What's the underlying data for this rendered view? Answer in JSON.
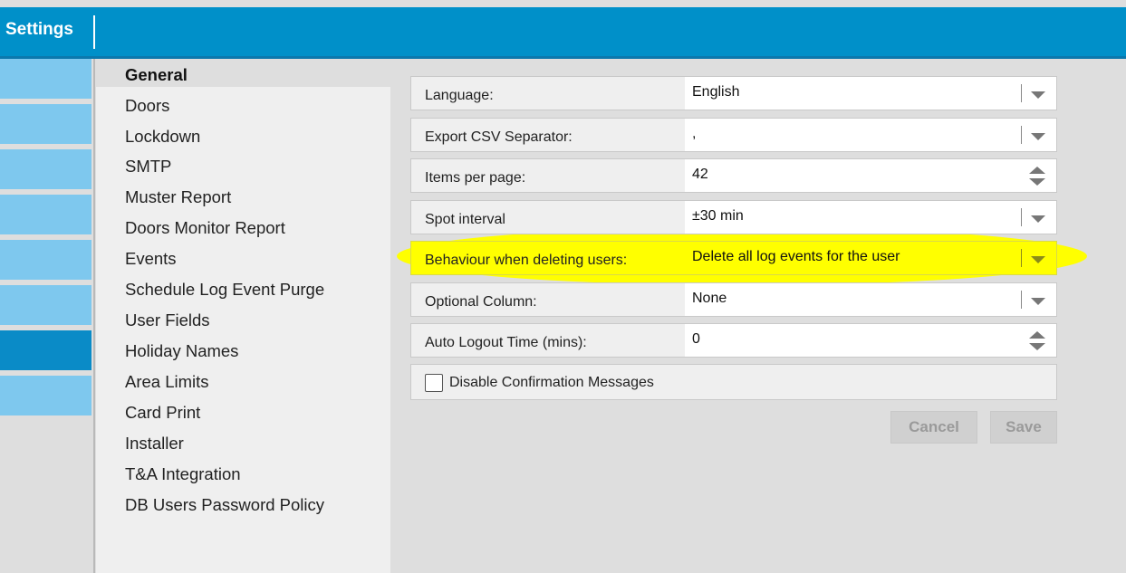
{
  "header": {
    "title": "Settings"
  },
  "leftnav": {
    "tiles": 8,
    "active_index": 6
  },
  "submenu": {
    "items": [
      {
        "label": "General",
        "active": true
      },
      {
        "label": "Doors"
      },
      {
        "label": "Lockdown"
      },
      {
        "label": "SMTP"
      },
      {
        "label": "Muster Report"
      },
      {
        "label": "Doors Monitor Report"
      },
      {
        "label": "Events"
      },
      {
        "label": "Schedule Log Event Purge"
      },
      {
        "label": "User Fields"
      },
      {
        "label": "Holiday Names"
      },
      {
        "label": "Area Limits"
      },
      {
        "label": "Card Print"
      },
      {
        "label": "Installer"
      },
      {
        "label": "T&A Integration"
      },
      {
        "label": "DB Users Password Policy"
      }
    ]
  },
  "settings": {
    "language": {
      "label": "Language:",
      "value": "English"
    },
    "csv_separator": {
      "label": "Export CSV Separator:",
      "value": ","
    },
    "items_per_page": {
      "label": "Items per page:",
      "value": "42"
    },
    "spot_interval": {
      "label": "Spot interval",
      "value": "±30 min"
    },
    "delete_behaviour": {
      "label": "Behaviour when deleting users:",
      "value": "Delete all log events for the user"
    },
    "optional_column": {
      "label": "Optional Column:",
      "value": "None"
    },
    "auto_logout": {
      "label": "Auto Logout Time (mins):",
      "value": "0"
    },
    "disable_confirmation": {
      "label": "Disable Confirmation Messages",
      "checked": false
    }
  },
  "buttons": {
    "cancel": "Cancel",
    "save": "Save"
  },
  "colors": {
    "header": "#0090c9",
    "tile": "#7ec8ee",
    "tile_active": "#0a8bc7",
    "highlight": "#ffff00"
  }
}
